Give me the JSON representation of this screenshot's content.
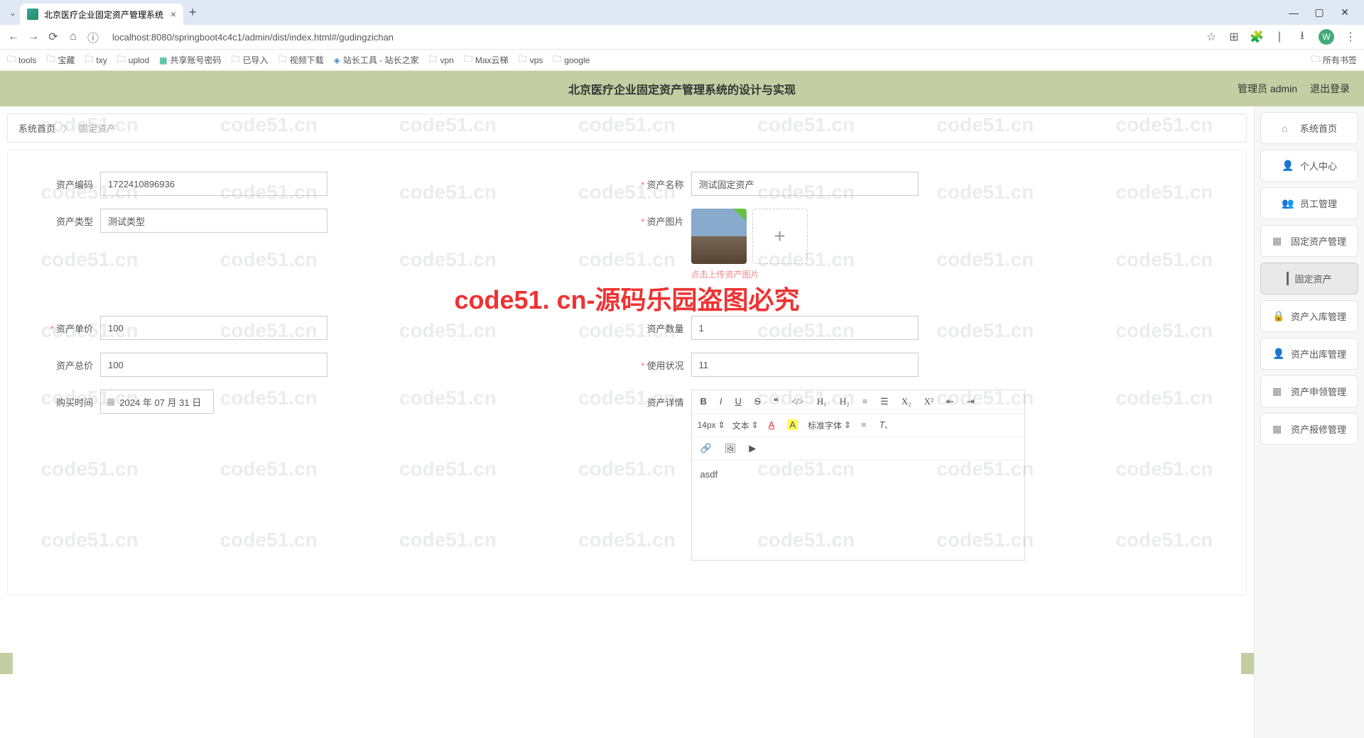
{
  "browser": {
    "tab_title": "北京医疗企业固定资产管理系统",
    "url": "localhost:8080/springboot4c4c1/admin/dist/index.html#/gudingzichan",
    "bookmarks": [
      "tools",
      "宝藏",
      "txy",
      "uplod",
      "共享账号密码",
      "已导入",
      "视频下载",
      "站长工具 - 站长之家",
      "vpn",
      "Max云梯",
      "vps",
      "google"
    ],
    "all_bookmarks": "所有书签"
  },
  "header": {
    "title": "北京医疗企业固定资产管理系统的设计与实现",
    "user": "管理员 admin",
    "logout": "退出登录"
  },
  "breadcrumb": {
    "home": "系统首页",
    "current": "固定资产"
  },
  "form": {
    "code_label": "资产编码",
    "code_value": "1722410896936",
    "name_label": "资产名称",
    "name_value": "测试固定资产",
    "type_label": "资产类型",
    "type_value": "测试类型",
    "image_label": "资产图片",
    "upload_tip": "点击上传资产图片",
    "price_label": "资产单价",
    "price_value": "100",
    "qty_label": "资产数量",
    "qty_value": "1",
    "total_label": "资产总价",
    "total_value": "100",
    "status_label": "使用状况",
    "status_value": "11",
    "buytime_label": "购买时间",
    "buytime_value": "2024 年 07 月 31 日",
    "detail_label": "资产详情",
    "editor_fontsize": "14px",
    "editor_fonttype": "文本",
    "editor_fontfamily": "标准字体",
    "editor_content": "asdf"
  },
  "sidebar": {
    "items": [
      {
        "icon": "⌂",
        "label": "系统首页"
      },
      {
        "icon": "👤",
        "label": "个人中心"
      },
      {
        "icon": "👥",
        "label": "员工管理"
      },
      {
        "icon": "▦",
        "label": "固定资产管理"
      },
      {
        "icon": "",
        "label": "固定资产",
        "active": true
      },
      {
        "icon": "🔒",
        "label": "资产入库管理"
      },
      {
        "icon": "👤",
        "label": "资产出库管理"
      },
      {
        "icon": "▦",
        "label": "资产申领管理"
      },
      {
        "icon": "▦",
        "label": "资产报修管理"
      }
    ]
  },
  "watermark": {
    "big": "code51. cn-源码乐园盗图必究",
    "small": "code51.cn"
  }
}
